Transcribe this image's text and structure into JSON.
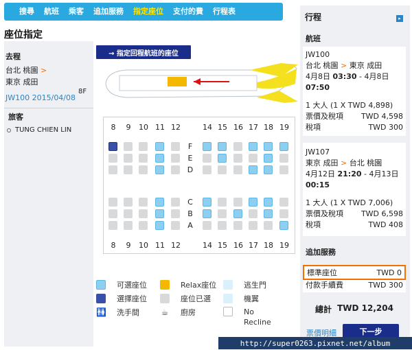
{
  "nav": {
    "items": [
      "搜尋",
      "航班",
      "乘客",
      "追加服務",
      "指定座位",
      "支付的費",
      "行程表"
    ],
    "active_index": 4
  },
  "page_title": "座位指定",
  "left": {
    "section_outbound": "去程",
    "origin": "台北 桃園",
    "arrow": ">",
    "destination": "東京 成田",
    "flight_date": "JW100 2015/04/08",
    "passengers_heading": "旅客",
    "passenger_name": "TUNG CHIEN LIN",
    "passenger_seat": "8F"
  },
  "return_button": "→ 指定回程航班的座位",
  "seatmap": {
    "columns": [
      "8",
      "9",
      "10",
      "11",
      "12",
      "14",
      "15",
      "16",
      "17",
      "18",
      "19"
    ],
    "letters_upper": [
      "F",
      "E",
      "D"
    ],
    "letters_lower": [
      "C",
      "B",
      "A"
    ],
    "selected_seat": "8F"
  },
  "legend": {
    "available": "可選座位",
    "relax": "Relax座位",
    "exit": "逃生門",
    "selected": "選擇座位",
    "taken": "座位已選",
    "crew": "機翼",
    "toilet": "洗手間",
    "galley": "廚房",
    "no_recline_1": "No",
    "no_recline_2": "Recline"
  },
  "colors": {
    "nav_bg": "#29a9e0",
    "nav_active": "#ffe600",
    "accent_orange": "#f07000",
    "button_blue": "#1a2d8a",
    "seat_available": "#8ccff0",
    "seat_selected": "#3a4fa8",
    "seat_taken": "#d7d9db",
    "relax_seat": "#f5b800"
  },
  "right": {
    "title": "行程",
    "flight_heading": "航班",
    "out": {
      "code": "JW100",
      "from": "台北 桃園",
      "to": "東京 成田",
      "date_line": "4月8日",
      "depart": "03:30",
      "date_line2": "- 4月8日",
      "arrive": "07:50",
      "fare_line": "1 大人 (1 X TWD 4,898)",
      "fare_label": "票價及稅項",
      "fare_value": "TWD 4,598",
      "tax_label": "稅項",
      "tax_value": "TWD 300"
    },
    "ret": {
      "code": "JW107",
      "from": "東京 成田",
      "to": "台北 桃園",
      "date_line": "4月12日",
      "depart": "21:20",
      "date_line2": "- 4月13日",
      "arrive": "00:15",
      "fare_line": "1 大人 (1 X TWD 7,006)",
      "fare_label": "票價及稅項",
      "fare_value": "TWD 6,598",
      "tax_label": "稅項",
      "tax_value": "TWD 408"
    },
    "services_heading": "追加服務",
    "std_seat_label": "標準座位",
    "std_seat_value": "TWD 0",
    "fee_label": "付款手續費",
    "fee_value": "TWD 300",
    "total_label": "總計",
    "total_value": "TWD 12,204",
    "price_link": "票價明細",
    "next_button": "下一步"
  },
  "watermark": "http://super0263.pixnet.net/album"
}
